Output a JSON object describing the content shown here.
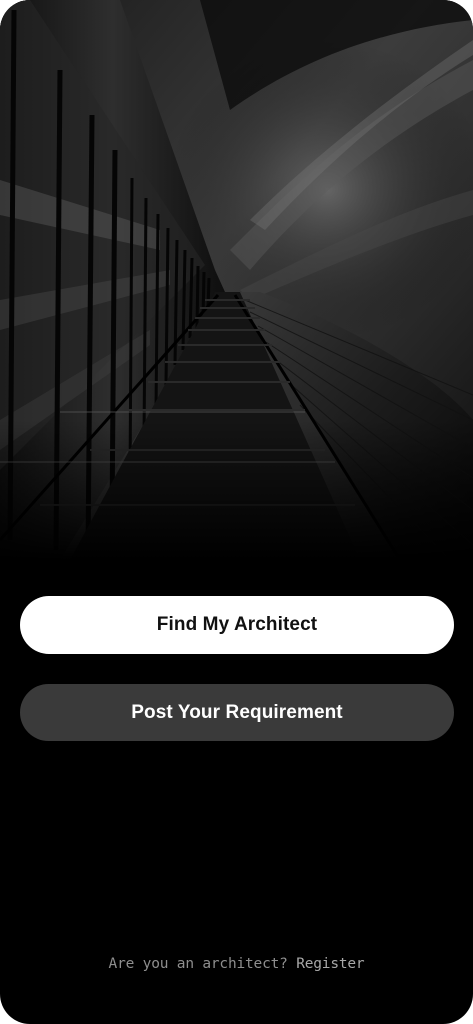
{
  "hero": {
    "image": "architecture-skyscraper-photo"
  },
  "actions": {
    "primary_label": "Find My Architect",
    "secondary_label": "Post Your Requirement"
  },
  "footer": {
    "prompt": "Are you an architect?",
    "link_label": "Register"
  },
  "colors": {
    "background": "#000000",
    "primary_button": "#ffffff",
    "secondary_button": "#3a3a3a",
    "footer_text": "#8e8e8e"
  }
}
